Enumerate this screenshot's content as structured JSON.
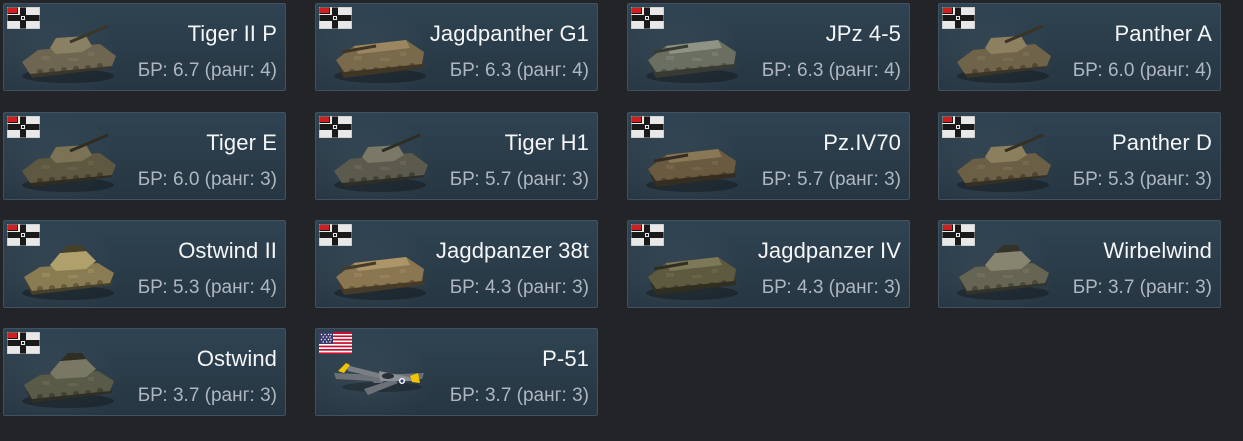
{
  "vehicles": [
    {
      "name": "Tiger II P",
      "br": "БР: 6.7 (ранг: 4)",
      "nation": "germany",
      "icon": "heavy-tank-icon"
    },
    {
      "name": "Jagdpanther G1",
      "br": "БР: 6.3 (ранг: 4)",
      "nation": "germany",
      "icon": "tank-destroyer-icon"
    },
    {
      "name": "JPz 4-5",
      "br": "БР: 6.3 (ранг: 4)",
      "nation": "germany",
      "icon": "tank-destroyer-icon"
    },
    {
      "name": "Panther A",
      "br": "БР: 6.0 (ранг: 4)",
      "nation": "germany",
      "icon": "medium-tank-icon"
    },
    {
      "name": "Tiger E",
      "br": "БР: 6.0 (ранг: 3)",
      "nation": "germany",
      "icon": "heavy-tank-icon"
    },
    {
      "name": "Tiger H1",
      "br": "БР: 5.7 (ранг: 3)",
      "nation": "germany",
      "icon": "heavy-tank-icon"
    },
    {
      "name": "Pz.IV70",
      "br": "БР: 5.7 (ранг: 3)",
      "nation": "germany",
      "icon": "tank-destroyer-icon"
    },
    {
      "name": "Panther D",
      "br": "БР: 5.3 (ранг: 3)",
      "nation": "germany",
      "icon": "medium-tank-icon"
    },
    {
      "name": "Ostwind II",
      "br": "БР: 5.3 (ранг: 4)",
      "nation": "germany",
      "icon": "spaa-icon"
    },
    {
      "name": "Jagdpanzer 38t",
      "br": "БР: 4.3 (ранг: 3)",
      "nation": "germany",
      "icon": "tank-destroyer-icon"
    },
    {
      "name": "Jagdpanzer IV",
      "br": "БР: 4.3 (ранг: 3)",
      "nation": "germany",
      "icon": "tank-destroyer-icon"
    },
    {
      "name": "Wirbelwind",
      "br": "БР: 3.7 (ранг: 3)",
      "nation": "germany",
      "icon": "spaa-icon"
    },
    {
      "name": "Ostwind",
      "br": "БР: 3.7 (ранг: 3)",
      "nation": "germany",
      "icon": "spaa-icon"
    },
    {
      "name": "P-51",
      "br": "БР: 3.7 (ранг: 3)",
      "nation": "usa",
      "icon": "fighter-plane-icon"
    }
  ],
  "colors": {
    "background": "#222427",
    "card": "#2f4352",
    "card_border": "#3e5262",
    "name_text": "#f4f5f6",
    "br_text": "#aeb7bf"
  }
}
